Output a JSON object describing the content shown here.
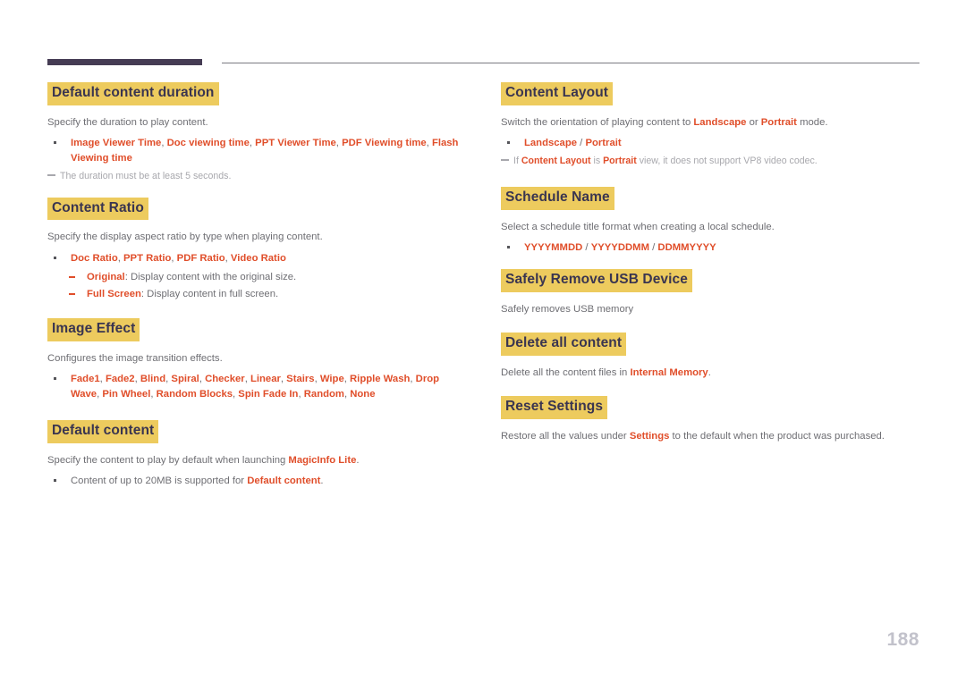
{
  "document": {
    "page_number": "188",
    "colors": {
      "heading_highlight": "#edcb5e",
      "heading_text": "#3a3550",
      "accent": "#e04e2a",
      "body_text": "#6e6e73",
      "note_text": "#a8a8ad",
      "rule_dark": "#453c54",
      "rule_light": "#7b7b82",
      "page_number": "#c2c2cb"
    }
  },
  "left_column": {
    "sections": [
      {
        "heading": "Default content duration",
        "intro": "Specify the duration to play content.",
        "bullet": {
          "terms": [
            "Image Viewer Time",
            "Doc viewing time",
            "PPT Viewer Time",
            "PDF Viewing time",
            "Flash Viewing time"
          ],
          "separator": ", "
        },
        "note": "The duration must be at least 5 seconds."
      },
      {
        "heading": "Content Ratio",
        "intro": "Specify the display aspect ratio by type when playing content.",
        "bullet": {
          "terms": [
            "Doc Ratio",
            "PPT Ratio",
            "PDF Ratio",
            "Video Ratio"
          ],
          "separator": ", "
        },
        "subbullets": [
          {
            "term": "Original",
            "text": ": Display content with the original size."
          },
          {
            "term": "Full Screen",
            "text": ": Display content in full screen."
          }
        ]
      },
      {
        "heading": "Image Effect",
        "intro": "Configures the image transition effects.",
        "bullet": {
          "terms": [
            "Fade1",
            "Fade2",
            "Blind",
            "Spiral",
            "Checker",
            "Linear",
            "Stairs",
            "Wipe",
            "Ripple Wash",
            "Drop Wave",
            "Pin Wheel",
            "Random Blocks",
            "Spin Fade In",
            "Random",
            "None"
          ],
          "separator": ", "
        }
      },
      {
        "heading": "Default content",
        "intro_parts": [
          {
            "text": "Specify the content to play by default when launching ",
            "accent": false
          },
          {
            "text": "MagicInfo Lite",
            "accent": true
          },
          {
            "text": ".",
            "accent": false
          }
        ],
        "bullet_parts": [
          {
            "text": "Content of up to 20MB is supported for ",
            "accent": false
          },
          {
            "text": "Default content",
            "accent": true
          },
          {
            "text": ".",
            "accent": false
          }
        ]
      }
    ]
  },
  "right_column": {
    "sections": [
      {
        "heading": "Content Layout",
        "intro_parts": [
          {
            "text": "Switch the orientation of playing content to ",
            "accent": false
          },
          {
            "text": "Landscape",
            "accent": true
          },
          {
            "text": " or ",
            "accent": false
          },
          {
            "text": "Portrait",
            "accent": true
          },
          {
            "text": " mode.",
            "accent": false
          }
        ],
        "bullet": {
          "terms": [
            "Landscape",
            "Portrait"
          ],
          "separator": " / "
        },
        "note_parts": [
          {
            "text": "If ",
            "accent": false
          },
          {
            "text": "Content Layout",
            "accent": true
          },
          {
            "text": " is ",
            "accent": false
          },
          {
            "text": "Portrait",
            "accent": true
          },
          {
            "text": " view, it does not support VP8 video codec.",
            "accent": false
          }
        ]
      },
      {
        "heading": "Schedule Name",
        "intro": "Select a schedule title format when creating a local schedule.",
        "bullet": {
          "terms": [
            "YYYYMMDD",
            "YYYYDDMM",
            "DDMMYYYY"
          ],
          "separator": " / "
        }
      },
      {
        "heading": "Safely Remove USB Device",
        "intro": "Safely removes USB memory"
      },
      {
        "heading": "Delete all content",
        "intro_parts": [
          {
            "text": "Delete all the content files in ",
            "accent": false
          },
          {
            "text": "Internal Memory",
            "accent": true
          },
          {
            "text": ".",
            "accent": false
          }
        ]
      },
      {
        "heading": "Reset Settings",
        "intro_parts": [
          {
            "text": "Restore all the values under ",
            "accent": false
          },
          {
            "text": "Settings",
            "accent": true
          },
          {
            "text": " to the default when the product was purchased.",
            "accent": false
          }
        ]
      }
    ]
  }
}
